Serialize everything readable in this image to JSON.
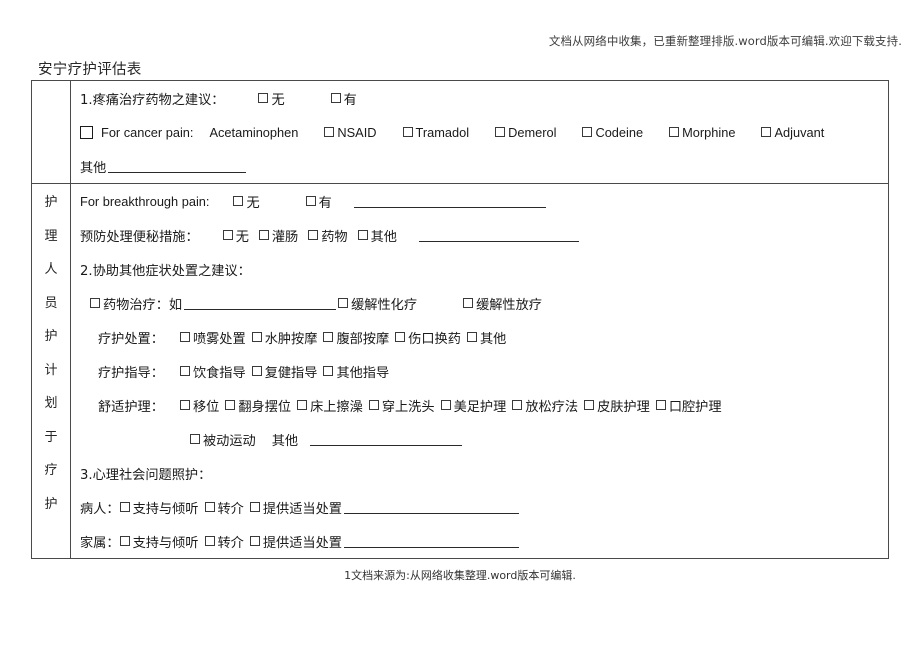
{
  "header_note": "文档从网络中收集，已重新整理排版.word版本可编辑.欢迎下载支持.",
  "title": "安宁疗护评估表",
  "side_column": {
    "chars": [
      "护",
      "理",
      "人",
      "员",
      "护",
      "计",
      "划",
      "于",
      "疗",
      "护"
    ]
  },
  "section1": {
    "heading": "1.疼痛治疗药物之建议：",
    "no_label": "无",
    "yes_label": "有",
    "cancer_pain_label": "For cancer pain:",
    "drugs": [
      "Acetaminophen",
      "NSAID",
      "Tramadol",
      "Demerol",
      "Codeine",
      "Morphine",
      "Adjuvant"
    ],
    "other_label": "其他"
  },
  "breakthrough": {
    "label": "For breakthrough pain:",
    "no_label": "无",
    "yes_label": "有"
  },
  "constipation": {
    "label": "预防处理便秘措施：",
    "options": [
      "无",
      "灌肠",
      "药物",
      "其他"
    ]
  },
  "section2": {
    "heading": "2.协助其他症状处置之建议：",
    "drug_therapy": {
      "label": "药物治疗：如",
      "option_chemo": "缓解性化疗",
      "option_radio": "缓解性放疗"
    },
    "care_treatment": {
      "label": "疗护处置：",
      "options": [
        "喷雾处置",
        "水肿按摩",
        "腹部按摩",
        "伤口换药",
        "其他"
      ]
    },
    "care_guidance": {
      "label": "疗护指导：",
      "options": [
        "饮食指导",
        "复健指导",
        "其他指导"
      ]
    },
    "comfort_care": {
      "label": "舒适护理：",
      "options": [
        "移位",
        "翻身摆位",
        "床上擦澡",
        "穿上洗头",
        "美足护理",
        "放松疗法",
        "皮肤护理",
        "口腔护理"
      ],
      "option_passive": "被动运动",
      "other_label": "其他"
    }
  },
  "section3": {
    "heading": "3.心理社会问题照护：",
    "patient": {
      "label": "病人：",
      "options": [
        "支持与倾听",
        "转介",
        "提供适当处置"
      ]
    },
    "family": {
      "label": "家属：",
      "options": [
        "支持与倾听",
        "转介",
        "提供适当处置"
      ]
    }
  },
  "footer": "1文档来源为:从网络收集整理.word版本可编辑."
}
